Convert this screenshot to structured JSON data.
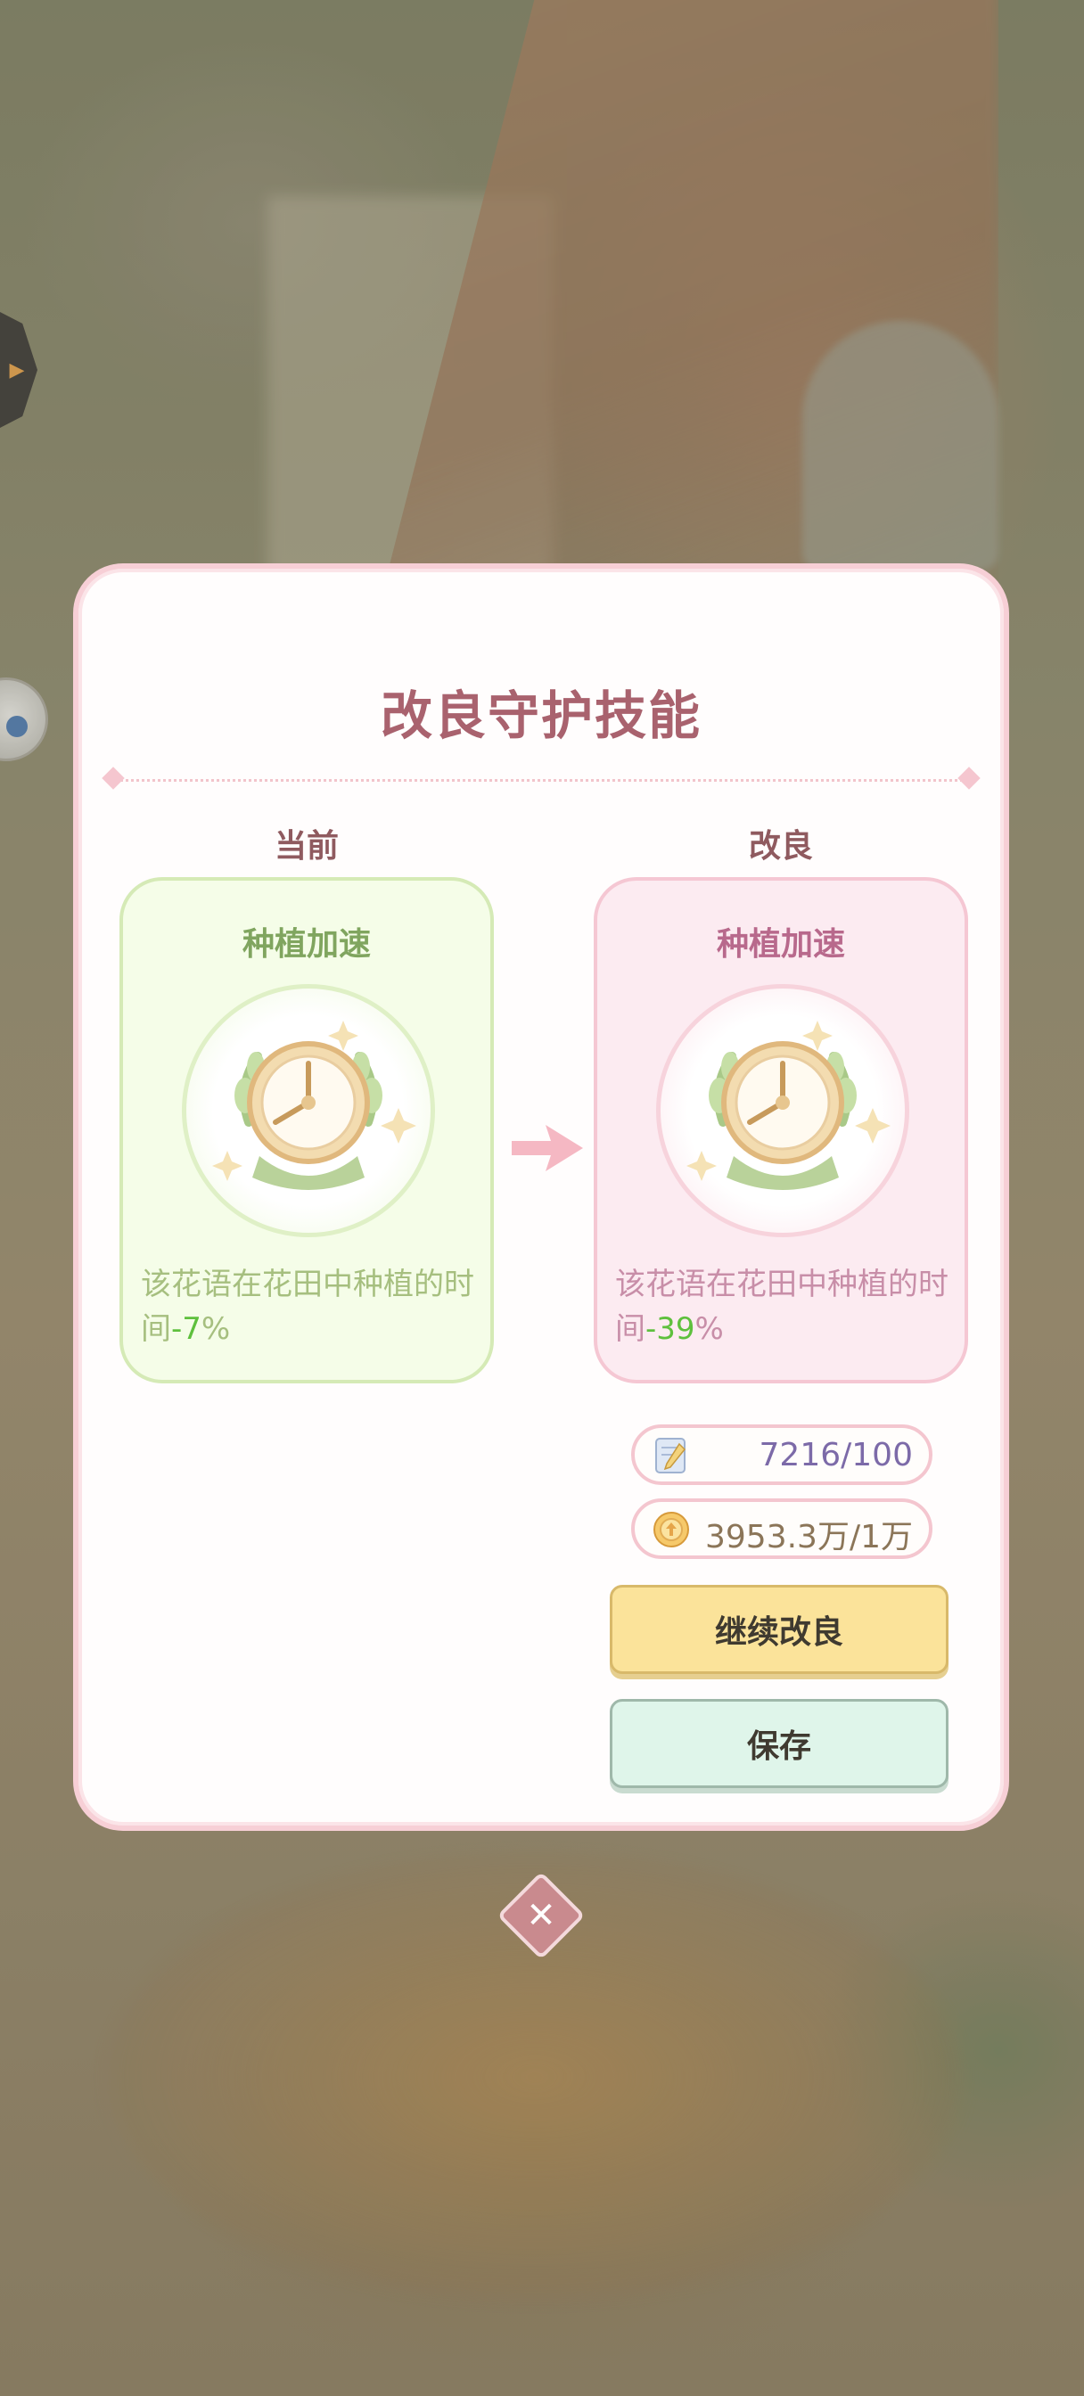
{
  "dialog": {
    "title": "改良守护技能",
    "current_label": "当前",
    "upgrade_label": "改良"
  },
  "current_skill": {
    "name": "种植加速",
    "desc_prefix": "该花语在花田中种植的时间",
    "desc_value": "-7",
    "desc_suffix": "%",
    "icon": "clock-wreath-icon"
  },
  "upgraded_skill": {
    "name": "种植加速",
    "desc_prefix": "该花语在花田中种植的时间",
    "desc_value": "-39",
    "desc_suffix": "%",
    "icon": "clock-wreath-icon"
  },
  "costs": {
    "notes": "7216/100",
    "notes_icon": "notebook-icon",
    "gold": "3953.3万/1万",
    "gold_icon": "coin-icon"
  },
  "buttons": {
    "continue": "继续改良",
    "save": "保存",
    "close": "✕"
  },
  "colors": {
    "title": "#a9626e",
    "current_card_bg": "#f5fde8",
    "upgrade_card_bg": "#fcebf1",
    "highlight_value": "#5ec03d",
    "continue_button": "#fbe39a",
    "save_button": "#dff5ea"
  }
}
